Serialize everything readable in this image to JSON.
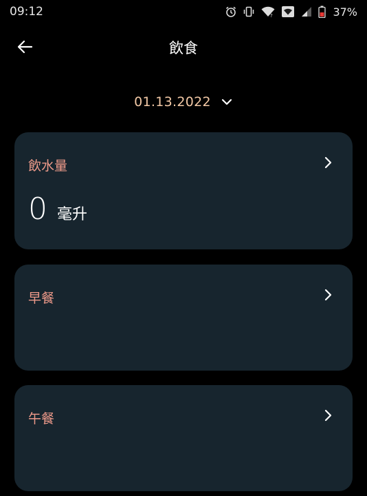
{
  "status_bar": {
    "time": "09:12",
    "battery_percent": "37%",
    "icons": [
      "alarm-icon",
      "vibrate-icon",
      "wifi-icon",
      "hotspot-icon",
      "signal-icon",
      "battery-icon"
    ],
    "battery_color": "#e53935"
  },
  "header": {
    "title": "飲食",
    "back_icon": "arrow-left-icon"
  },
  "date_selector": {
    "date": "01.13.2022",
    "icon": "chevron-down-icon"
  },
  "cards": {
    "water": {
      "title": "飲水量",
      "value": "0",
      "unit": "毫升"
    },
    "breakfast": {
      "title": "早餐"
    },
    "lunch": {
      "title": "午餐"
    }
  },
  "colors": {
    "background": "#000000",
    "card": "#17252e",
    "card_title": "#ee9a8a",
    "date": "#f3c9a6"
  }
}
